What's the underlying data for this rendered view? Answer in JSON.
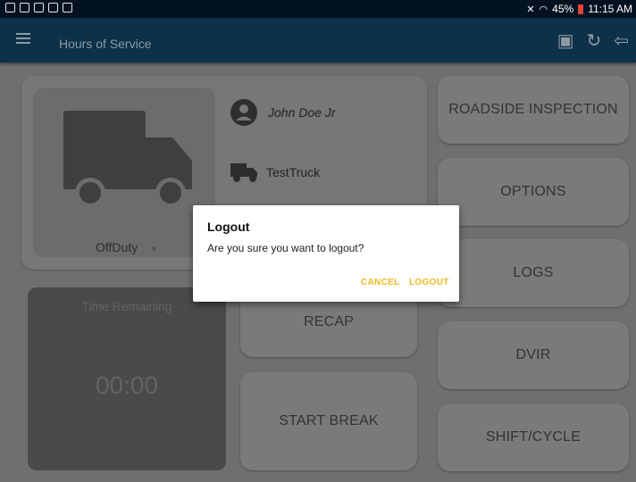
{
  "status_bar": {
    "battery": "45%",
    "time": "11:15 AM"
  },
  "app_bar": {
    "title": "Hours of Service"
  },
  "driver": {
    "name": "John Doe Jr",
    "truck": "TestTruck",
    "status": "OffDuty"
  },
  "time_remaining": {
    "label": "Time Remaining",
    "value": "00:00"
  },
  "buttons": {
    "recap": "RECAP",
    "start_break": "START BREAK",
    "roadside_inspection": "ROADSIDE INSPECTION",
    "options": "OPTIONS",
    "logs": "LOGS",
    "dvir": "DVIR",
    "shift_cycle": "SHIFT/CYCLE"
  },
  "dialog": {
    "title": "Logout",
    "message": "Are you sure you want to logout?",
    "cancel": "CANCEL",
    "logout": "LOGOUT"
  },
  "colors": {
    "app_bar": "#0c3148",
    "status_bar": "#031221",
    "dialog_action": "#f0b81e"
  }
}
